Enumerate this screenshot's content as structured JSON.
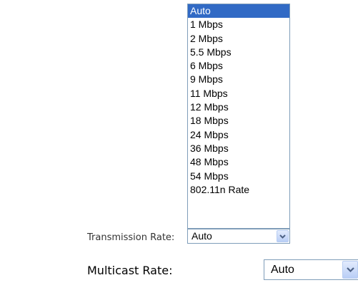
{
  "transmission_rate": {
    "label": "Transmission Rate:",
    "selected": "Auto",
    "options": [
      "Auto",
      "1 Mbps",
      "2 Mbps",
      "5.5 Mbps",
      "6 Mbps",
      "9 Mbps",
      "11 Mbps",
      "12 Mbps",
      "18 Mbps",
      "24 Mbps",
      "36 Mbps",
      "48 Mbps",
      "54 Mbps",
      "802.11n Rate"
    ],
    "highlighted_option": "Auto"
  },
  "multicast_rate": {
    "label": "Multicast Rate:",
    "selected": "Auto"
  },
  "colors": {
    "highlight": "#316ac5",
    "border": "#7f9db9",
    "arrow": "#4d6185"
  },
  "icons": {
    "dropdown": "chevron-down-icon"
  }
}
